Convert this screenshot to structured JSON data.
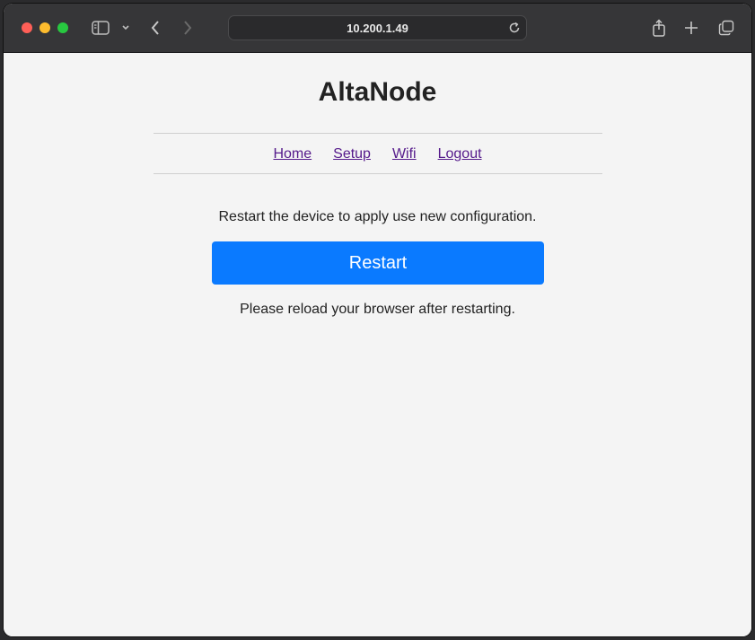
{
  "browser": {
    "address": "10.200.1.49",
    "icons": {
      "close": "close-icon",
      "minimize": "minimize-icon",
      "zoom": "zoom-icon",
      "sidebar": "sidebar-icon",
      "sidebar_menu": "chevron-down-icon",
      "back": "back-icon",
      "forward": "forward-icon",
      "reload": "reload-icon",
      "share": "share-icon",
      "new_tab": "plus-icon",
      "tabs": "tab-overview-icon"
    }
  },
  "page": {
    "title": "AltaNode",
    "nav": [
      "Home",
      "Setup",
      "Wifi",
      "Logout"
    ],
    "instruction": "Restart the device to apply use new configuration.",
    "button_label": "Restart",
    "note": "Please reload your browser after restarting."
  },
  "colors": {
    "accent": "#0a7aff",
    "link": "#551a8b",
    "page_background": "#f4f4f4",
    "toolbar": "#363638"
  }
}
